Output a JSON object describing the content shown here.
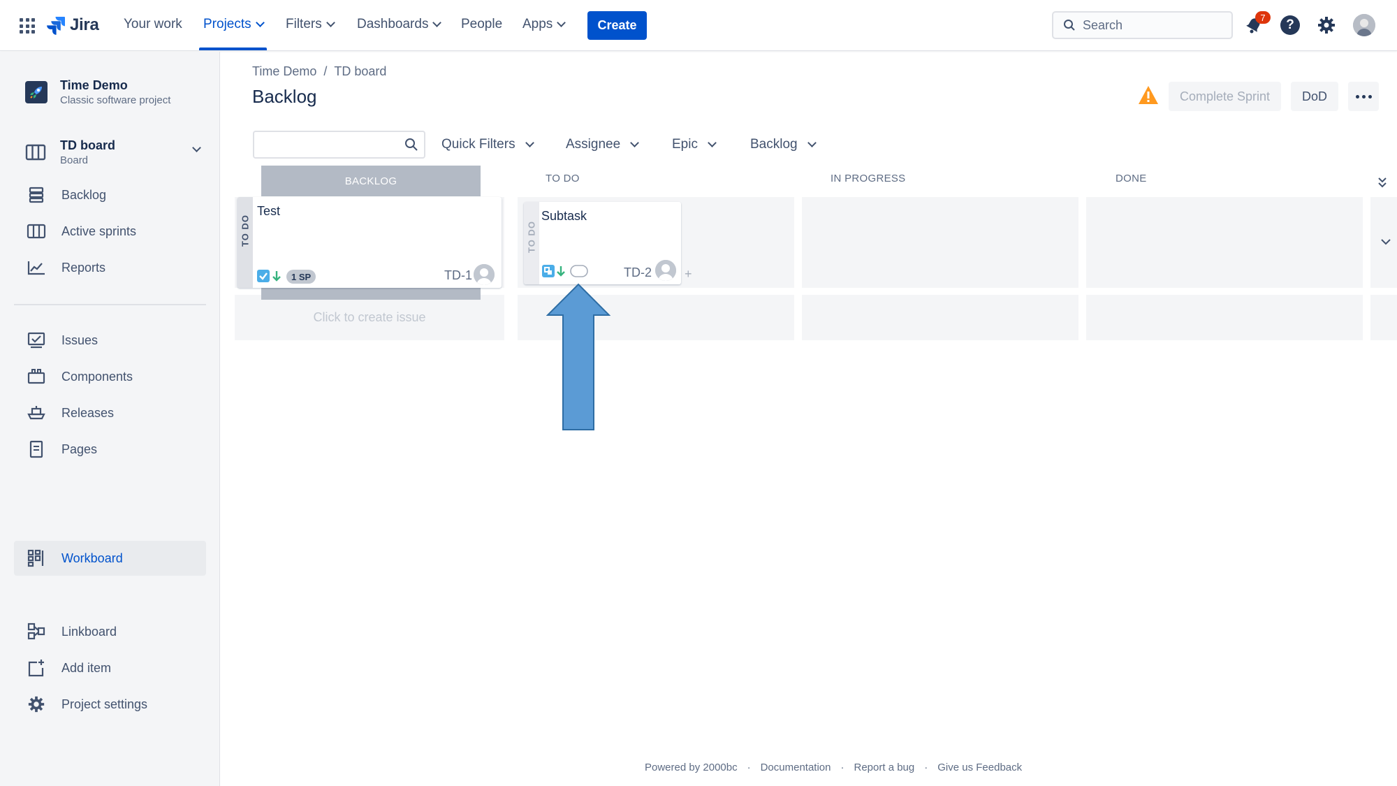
{
  "topnav": {
    "logo_text": "Jira",
    "items": [
      {
        "label": "Your work"
      },
      {
        "label": "Projects"
      },
      {
        "label": "Filters"
      },
      {
        "label": "Dashboards"
      },
      {
        "label": "People"
      },
      {
        "label": "Apps"
      }
    ],
    "create_label": "Create",
    "search_placeholder": "Search",
    "notification_count": "7"
  },
  "sidebar": {
    "project_name": "Time Demo",
    "project_type": "Classic software project",
    "board_name": "TD board",
    "board_sub": "Board",
    "items": [
      {
        "label": "Backlog"
      },
      {
        "label": "Active sprints"
      },
      {
        "label": "Reports"
      },
      {
        "label": "Issues"
      },
      {
        "label": "Components"
      },
      {
        "label": "Releases"
      },
      {
        "label": "Pages"
      },
      {
        "label": "Workboard"
      },
      {
        "label": "Linkboard"
      },
      {
        "label": "Add item"
      },
      {
        "label": "Project settings"
      }
    ]
  },
  "main": {
    "breadcrumb": [
      "Time Demo",
      "/",
      "TD board"
    ],
    "title": "Backlog",
    "complete_sprint_label": "Complete Sprint",
    "dod_label": "DoD",
    "filters": [
      "Quick Filters",
      "Assignee",
      "Epic",
      "Backlog"
    ],
    "columns": [
      "BACKLOG",
      "TO DO",
      "IN PROGRESS",
      "DONE"
    ],
    "cards": [
      {
        "title": "Test",
        "key": "TD-1",
        "status": "TO DO",
        "points": "1 SP"
      },
      {
        "title": "Subtask",
        "key": "TD-2",
        "status": "TO DO"
      }
    ],
    "create_issue_label": "Click to create issue",
    "plus_label": "+"
  },
  "footer": {
    "items": [
      "Powered by 2000bc",
      "·",
      "Documentation",
      "·",
      "Report a bug",
      "·",
      "Give us Feedback"
    ]
  },
  "colors": {
    "accent": "#0052cc",
    "sidebar_bg": "#f4f5f7",
    "warning": "#ff991f",
    "arrow": "#5b9bd5",
    "badge": "#de350b"
  }
}
